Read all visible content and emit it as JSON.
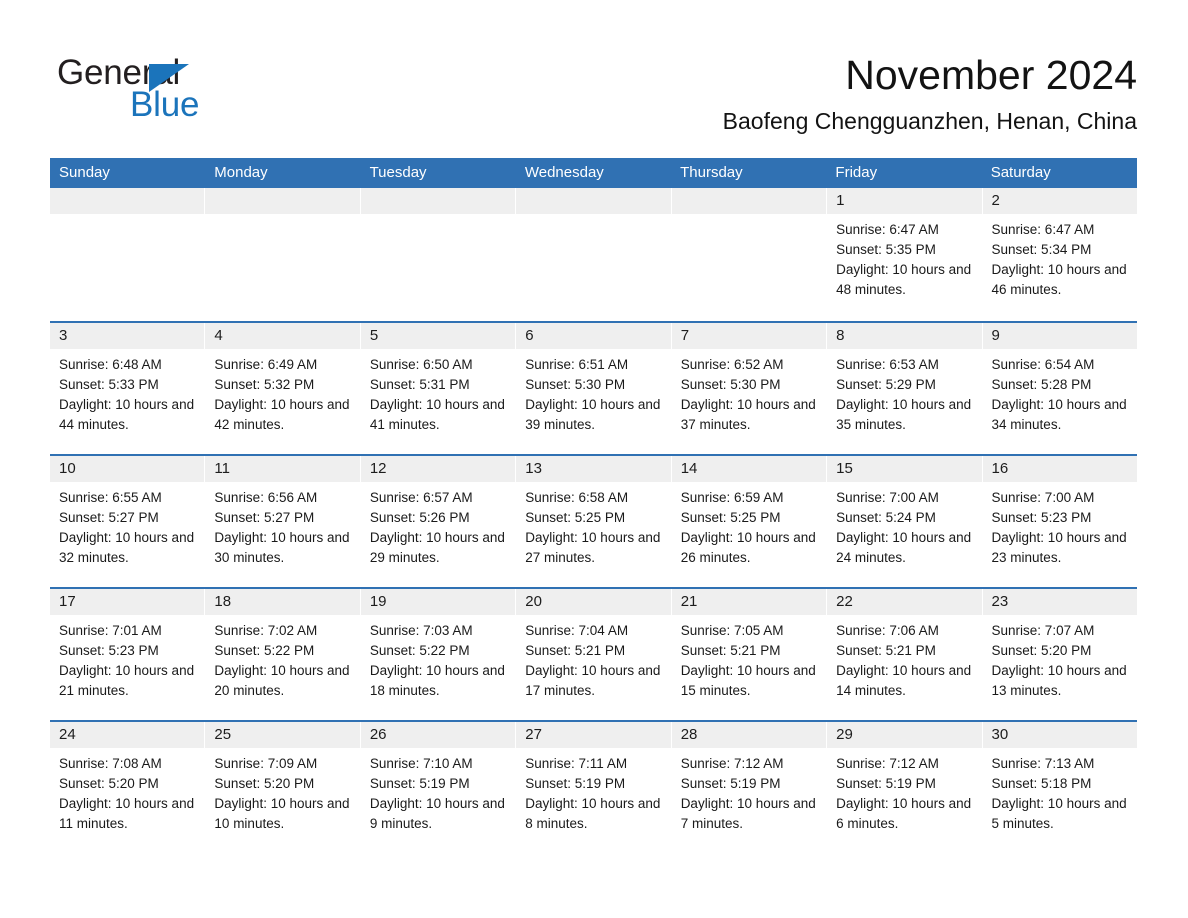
{
  "brand": {
    "name_part1": "General",
    "name_part2": "Blue",
    "logo_icon": "triangle-icon",
    "accent_color": "#1b74bb"
  },
  "header": {
    "month_title": "November 2024",
    "location": "Baofeng Chengguanzhen, Henan, China"
  },
  "calendar": {
    "header_color": "#3071b3",
    "daynum_bg": "#efefef",
    "weekdays": [
      "Sunday",
      "Monday",
      "Tuesday",
      "Wednesday",
      "Thursday",
      "Friday",
      "Saturday"
    ],
    "weeks": [
      [
        {
          "day": "",
          "sunrise": "",
          "sunset": "",
          "daylight": ""
        },
        {
          "day": "",
          "sunrise": "",
          "sunset": "",
          "daylight": ""
        },
        {
          "day": "",
          "sunrise": "",
          "sunset": "",
          "daylight": ""
        },
        {
          "day": "",
          "sunrise": "",
          "sunset": "",
          "daylight": ""
        },
        {
          "day": "",
          "sunrise": "",
          "sunset": "",
          "daylight": ""
        },
        {
          "day": "1",
          "sunrise": "Sunrise: 6:47 AM",
          "sunset": "Sunset: 5:35 PM",
          "daylight": "Daylight: 10 hours and 48 minutes."
        },
        {
          "day": "2",
          "sunrise": "Sunrise: 6:47 AM",
          "sunset": "Sunset: 5:34 PM",
          "daylight": "Daylight: 10 hours and 46 minutes."
        }
      ],
      [
        {
          "day": "3",
          "sunrise": "Sunrise: 6:48 AM",
          "sunset": "Sunset: 5:33 PM",
          "daylight": "Daylight: 10 hours and 44 minutes."
        },
        {
          "day": "4",
          "sunrise": "Sunrise: 6:49 AM",
          "sunset": "Sunset: 5:32 PM",
          "daylight": "Daylight: 10 hours and 42 minutes."
        },
        {
          "day": "5",
          "sunrise": "Sunrise: 6:50 AM",
          "sunset": "Sunset: 5:31 PM",
          "daylight": "Daylight: 10 hours and 41 minutes."
        },
        {
          "day": "6",
          "sunrise": "Sunrise: 6:51 AM",
          "sunset": "Sunset: 5:30 PM",
          "daylight": "Daylight: 10 hours and 39 minutes."
        },
        {
          "day": "7",
          "sunrise": "Sunrise: 6:52 AM",
          "sunset": "Sunset: 5:30 PM",
          "daylight": "Daylight: 10 hours and 37 minutes."
        },
        {
          "day": "8",
          "sunrise": "Sunrise: 6:53 AM",
          "sunset": "Sunset: 5:29 PM",
          "daylight": "Daylight: 10 hours and 35 minutes."
        },
        {
          "day": "9",
          "sunrise": "Sunrise: 6:54 AM",
          "sunset": "Sunset: 5:28 PM",
          "daylight": "Daylight: 10 hours and 34 minutes."
        }
      ],
      [
        {
          "day": "10",
          "sunrise": "Sunrise: 6:55 AM",
          "sunset": "Sunset: 5:27 PM",
          "daylight": "Daylight: 10 hours and 32 minutes."
        },
        {
          "day": "11",
          "sunrise": "Sunrise: 6:56 AM",
          "sunset": "Sunset: 5:27 PM",
          "daylight": "Daylight: 10 hours and 30 minutes."
        },
        {
          "day": "12",
          "sunrise": "Sunrise: 6:57 AM",
          "sunset": "Sunset: 5:26 PM",
          "daylight": "Daylight: 10 hours and 29 minutes."
        },
        {
          "day": "13",
          "sunrise": "Sunrise: 6:58 AM",
          "sunset": "Sunset: 5:25 PM",
          "daylight": "Daylight: 10 hours and 27 minutes."
        },
        {
          "day": "14",
          "sunrise": "Sunrise: 6:59 AM",
          "sunset": "Sunset: 5:25 PM",
          "daylight": "Daylight: 10 hours and 26 minutes."
        },
        {
          "day": "15",
          "sunrise": "Sunrise: 7:00 AM",
          "sunset": "Sunset: 5:24 PM",
          "daylight": "Daylight: 10 hours and 24 minutes."
        },
        {
          "day": "16",
          "sunrise": "Sunrise: 7:00 AM",
          "sunset": "Sunset: 5:23 PM",
          "daylight": "Daylight: 10 hours and 23 minutes."
        }
      ],
      [
        {
          "day": "17",
          "sunrise": "Sunrise: 7:01 AM",
          "sunset": "Sunset: 5:23 PM",
          "daylight": "Daylight: 10 hours and 21 minutes."
        },
        {
          "day": "18",
          "sunrise": "Sunrise: 7:02 AM",
          "sunset": "Sunset: 5:22 PM",
          "daylight": "Daylight: 10 hours and 20 minutes."
        },
        {
          "day": "19",
          "sunrise": "Sunrise: 7:03 AM",
          "sunset": "Sunset: 5:22 PM",
          "daylight": "Daylight: 10 hours and 18 minutes."
        },
        {
          "day": "20",
          "sunrise": "Sunrise: 7:04 AM",
          "sunset": "Sunset: 5:21 PM",
          "daylight": "Daylight: 10 hours and 17 minutes."
        },
        {
          "day": "21",
          "sunrise": "Sunrise: 7:05 AM",
          "sunset": "Sunset: 5:21 PM",
          "daylight": "Daylight: 10 hours and 15 minutes."
        },
        {
          "day": "22",
          "sunrise": "Sunrise: 7:06 AM",
          "sunset": "Sunset: 5:21 PM",
          "daylight": "Daylight: 10 hours and 14 minutes."
        },
        {
          "day": "23",
          "sunrise": "Sunrise: 7:07 AM",
          "sunset": "Sunset: 5:20 PM",
          "daylight": "Daylight: 10 hours and 13 minutes."
        }
      ],
      [
        {
          "day": "24",
          "sunrise": "Sunrise: 7:08 AM",
          "sunset": "Sunset: 5:20 PM",
          "daylight": "Daylight: 10 hours and 11 minutes."
        },
        {
          "day": "25",
          "sunrise": "Sunrise: 7:09 AM",
          "sunset": "Sunset: 5:20 PM",
          "daylight": "Daylight: 10 hours and 10 minutes."
        },
        {
          "day": "26",
          "sunrise": "Sunrise: 7:10 AM",
          "sunset": "Sunset: 5:19 PM",
          "daylight": "Daylight: 10 hours and 9 minutes."
        },
        {
          "day": "27",
          "sunrise": "Sunrise: 7:11 AM",
          "sunset": "Sunset: 5:19 PM",
          "daylight": "Daylight: 10 hours and 8 minutes."
        },
        {
          "day": "28",
          "sunrise": "Sunrise: 7:12 AM",
          "sunset": "Sunset: 5:19 PM",
          "daylight": "Daylight: 10 hours and 7 minutes."
        },
        {
          "day": "29",
          "sunrise": "Sunrise: 7:12 AM",
          "sunset": "Sunset: 5:19 PM",
          "daylight": "Daylight: 10 hours and 6 minutes."
        },
        {
          "day": "30",
          "sunrise": "Sunrise: 7:13 AM",
          "sunset": "Sunset: 5:18 PM",
          "daylight": "Daylight: 10 hours and 5 minutes."
        }
      ]
    ]
  }
}
